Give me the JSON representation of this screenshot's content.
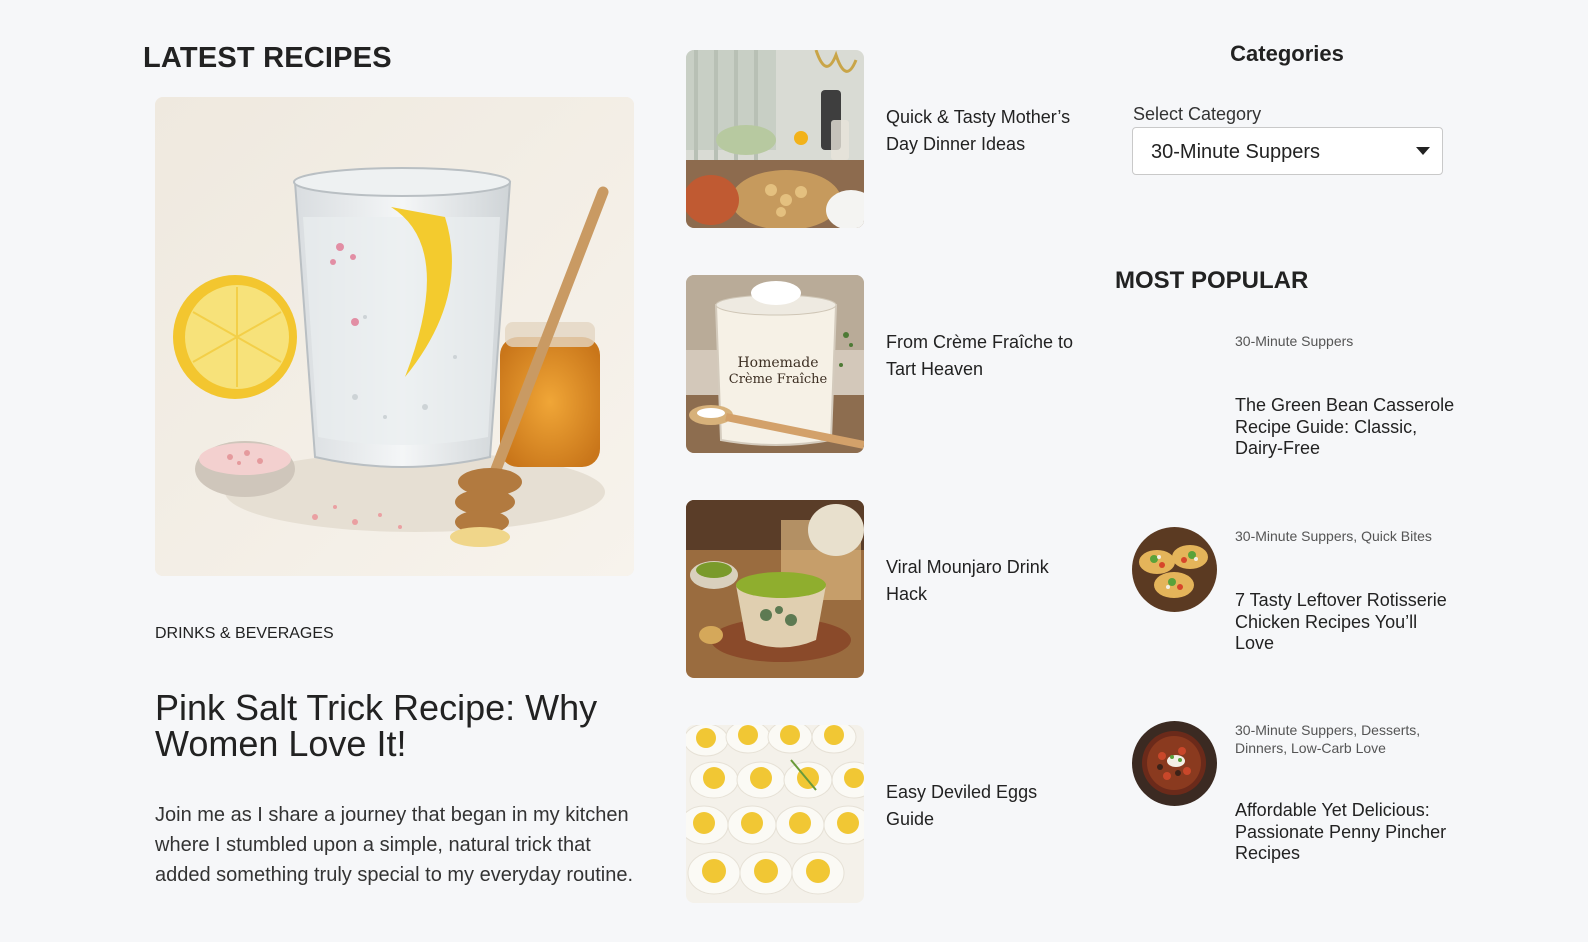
{
  "latest": {
    "heading": "LATEST RECIPES",
    "featured": {
      "category": "DRINKS & BEVERAGES",
      "title": "Pink Salt Trick Recipe: Why Women Love It!",
      "excerpt": "Join me as I share a journey that began in my kitchen where I stumbled upon a simple, natural trick that added something truly special to my everyday routine."
    },
    "items": [
      {
        "title": "Quick & Tasty Mother’s Day Dinner Ideas"
      },
      {
        "title": "From Crème Fraîche to Tart Heaven"
      },
      {
        "title": "Viral Mounjaro Drink Hack"
      },
      {
        "title": "Easy Deviled Eggs Guide"
      }
    ]
  },
  "sidebar": {
    "categories_heading": "Categories",
    "select_label": "Select Category",
    "selected_category": "30-Minute Suppers",
    "jar_label_line1": "Homemade",
    "jar_label_line2": "Crème Fraîche",
    "popular_heading": "MOST POPULAR",
    "popular": [
      {
        "categories": "30-Minute Suppers",
        "title": "The Green Bean Casserole Recipe Guide: Classic, Dairy-Free"
      },
      {
        "categories": "30-Minute Suppers, Quick Bites",
        "title": "7 Tasty Leftover Rotisserie Chicken Recipes You’ll Love"
      },
      {
        "categories": "30-Minute Suppers, Desserts, Dinners, Low-Carb Love",
        "title": "Affordable Yet Delicious: Passionate Penny Pincher Recipes"
      }
    ]
  }
}
